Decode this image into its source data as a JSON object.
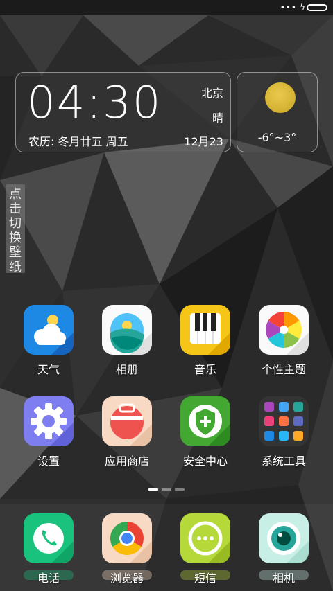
{
  "status": {
    "signal_dots": "•••",
    "charging": "ϟ"
  },
  "clock": {
    "time": "04:30",
    "city": "北京",
    "condition": "晴",
    "lunar": "农历: 冬月廿五  周五",
    "date": "12月23"
  },
  "weather": {
    "temp": "-6°~3°"
  },
  "wallpaper_switch": "点击切换壁纸",
  "apps": [
    {
      "label": "天气",
      "icon": "weather-icon"
    },
    {
      "label": "相册",
      "icon": "gallery-icon"
    },
    {
      "label": "音乐",
      "icon": "music-icon"
    },
    {
      "label": "个性主题",
      "icon": "themes-icon"
    },
    {
      "label": "设置",
      "icon": "settings-icon"
    },
    {
      "label": "应用商店",
      "icon": "app-store-icon"
    },
    {
      "label": "安全中心",
      "icon": "security-icon"
    },
    {
      "label": "系统工具",
      "icon": "tools-folder-icon"
    }
  ],
  "dock": [
    {
      "label": "电话",
      "icon": "phone-icon"
    },
    {
      "label": "浏览器",
      "icon": "browser-icon"
    },
    {
      "label": "短信",
      "icon": "messages-icon"
    },
    {
      "label": "相机",
      "icon": "camera-icon"
    }
  ],
  "pager": {
    "pages": 3,
    "current": 1
  },
  "colors": {
    "accent_weather": "#1e88e5",
    "accent_music": "#f5c518",
    "accent_security": "#43a832",
    "accent_phone": "#19c37d"
  }
}
